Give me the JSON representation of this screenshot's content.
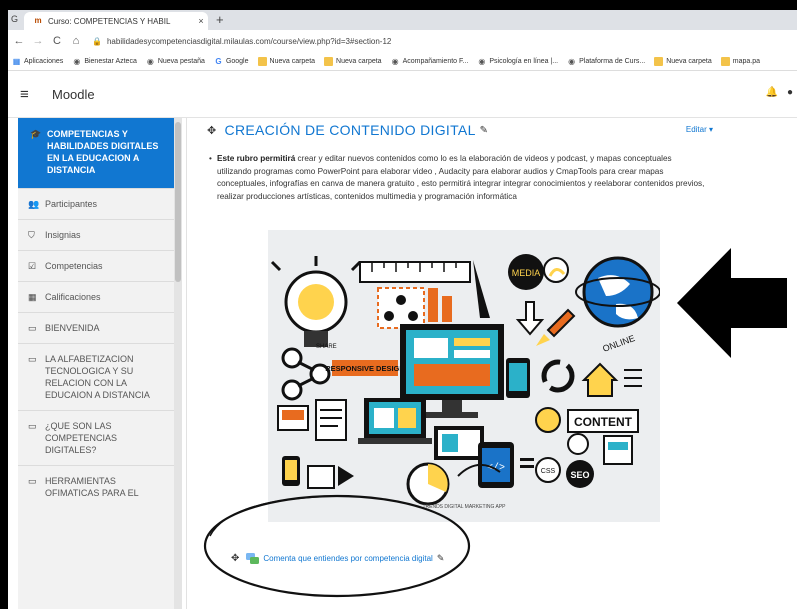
{
  "browser": {
    "tab_title": "Curso: COMPETENCIAS Y HABIL",
    "tab_close": "×",
    "new_tab": "+",
    "url": "habilidadesycompetenciasdigital.milaulas.com/course/view.php?id=3#section-12",
    "bookmarks": [
      {
        "label": "Aplicaciones",
        "icon": "apps-grid-icon"
      },
      {
        "label": "Bienestar Azteca",
        "icon": "globe-icon"
      },
      {
        "label": "Nueva pestaña",
        "icon": "globe-icon"
      },
      {
        "label": "Google",
        "icon": "google-icon"
      },
      {
        "label": "Nueva carpeta",
        "icon": "folder-icon"
      },
      {
        "label": "Nueva carpeta",
        "icon": "folder-icon"
      },
      {
        "label": "Acompañamiento F...",
        "icon": "globe-icon"
      },
      {
        "label": "Psicología en línea |...",
        "icon": "globe-icon"
      },
      {
        "label": "Plataforma de Curs...",
        "icon": "globe-icon"
      },
      {
        "label": "Nueva carpeta",
        "icon": "folder-icon"
      },
      {
        "label": "mapa.pa",
        "icon": "folder-icon"
      }
    ]
  },
  "moodle": {
    "brand": "Moodle"
  },
  "sidebar": {
    "course": "COMPETENCIAS Y HABILIDADES DIGITALES EN LA EDUCACION A DISTANCIA",
    "items": [
      {
        "label": "Participantes",
        "icon": "users-icon"
      },
      {
        "label": "Insignias",
        "icon": "shield-icon"
      },
      {
        "label": "Competencias",
        "icon": "checkbox-icon"
      },
      {
        "label": "Calificaciones",
        "icon": "table-icon"
      },
      {
        "label": "BIENVENIDA",
        "icon": "folder-icon"
      },
      {
        "label": "LA ALFABETIZACION TECNOLOGICA Y SU RELACION CON LA EDUCAION A DISTANCIA",
        "icon": "folder-icon"
      },
      {
        "label": "¿QUE SON LAS COMPETENCIAS DIGITALES?",
        "icon": "folder-icon"
      },
      {
        "label": "HERRAMIENTAS OFIMATICAS PARA EL",
        "icon": "folder-icon"
      }
    ]
  },
  "section": {
    "title": "CREACIÓN DE CONTENIDO DIGITAL",
    "edit_menu": "Editar ▾",
    "desc_bold": "Este rubro permitirá",
    "desc_rest": " crear y editar nuevos contenidos  como lo es la  elaboración de videos y podcast, y mapas conceptuales utilizando programas  como PowerPoint para elaborar video , Audacity para elaborar  audios y CmapTools para crear  mapas  conceptuales, infografías en canva de manera  gratuito , esto permitirá  integrar integrar conocimientos y reelaborar contenidos previos, realizar producciones artísticas, contenidos multimedia y programación informática",
    "activity": "Comenta que entiendes por competencia digital"
  },
  "illustration": {
    "media": "MEDIA",
    "online": "ONLINE",
    "responsive": "RESPONSIVE DESIGN",
    "content": "CONTENT",
    "seo": "SEO",
    "css": "CSS",
    "share": "SHARE",
    "code": "</>",
    "brand": "TRENDS DIGITAL MARKETING APP"
  }
}
